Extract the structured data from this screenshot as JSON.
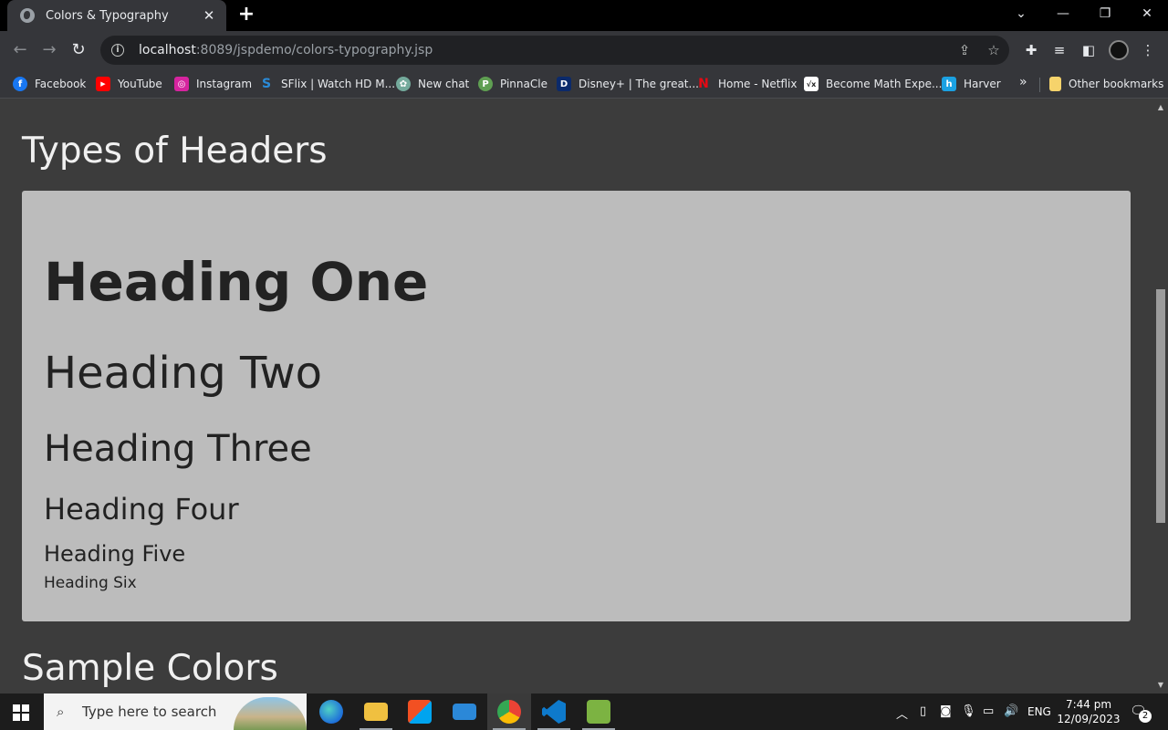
{
  "browser": {
    "tab_title": "Colors & Typography",
    "tab_close": "✕",
    "new_tab": "+",
    "url_host": "localhost",
    "url_rest": ":8089/jspdemo/colors-typography.jsp"
  },
  "bookmarks": [
    {
      "label": "Facebook",
      "icon": "facebook-icon",
      "color": "#1877f2",
      "glyph": "f"
    },
    {
      "label": "YouTube",
      "icon": "youtube-icon",
      "color": "#ff0000",
      "glyph": "▶"
    },
    {
      "label": "Instagram",
      "icon": "instagram-icon",
      "color": "#d6249f",
      "glyph": "◎"
    },
    {
      "label": "SFlix | Watch HD M...",
      "icon": "sflix-icon",
      "color": "#2a8bd8",
      "glyph": "S"
    },
    {
      "label": "New chat",
      "icon": "chatgpt-icon",
      "color": "#74aa9c",
      "glyph": "✿"
    },
    {
      "label": "PinnaCle",
      "icon": "pinnacle-icon",
      "color": "#5f9f52",
      "glyph": "P"
    },
    {
      "label": "Disney+ | The great...",
      "icon": "disney-icon",
      "color": "#0b2a6b",
      "glyph": "D"
    },
    {
      "label": "Home - Netflix",
      "icon": "netflix-icon",
      "color": "#e50914",
      "glyph": "N"
    },
    {
      "label": "Become Math Expe...",
      "icon": "math-icon",
      "color": "#ffffff",
      "glyph": "√x"
    },
    {
      "label": "Harver",
      "icon": "harver-icon",
      "color": "#1ba1e2",
      "glyph": "h"
    }
  ],
  "bookmarks_other": "Other bookmarks",
  "page": {
    "section_headers_title": "Types of Headers",
    "headings": {
      "h1": "Heading One",
      "h2": "Heading Two",
      "h3": "Heading Three",
      "h4": "Heading Four",
      "h5": "Heading Five",
      "h6": "Heading Six"
    },
    "section_colors_title": "Sample Colors"
  },
  "taskbar": {
    "search_placeholder": "Type here to search",
    "language": "ENG",
    "time": "7:44 pm",
    "date": "12/09/2023",
    "notification_count": "2"
  },
  "colors": {
    "page_bg": "#3c3c3c",
    "card_bg": "#bcbcbc",
    "heading_text": "#222222"
  }
}
